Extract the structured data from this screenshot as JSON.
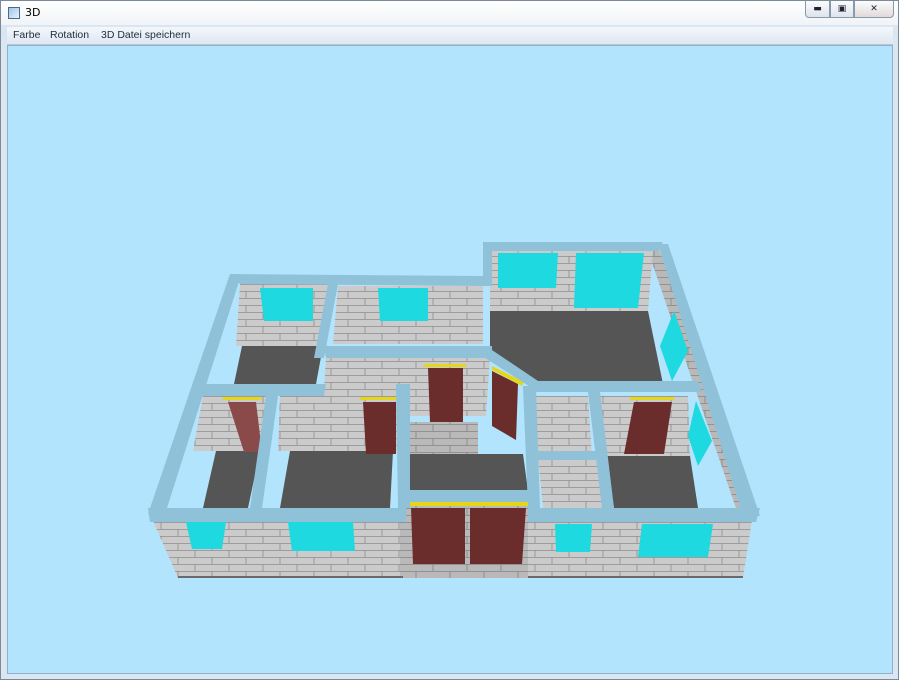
{
  "window": {
    "title": "3D",
    "app_icon": "window-icon",
    "controls": {
      "minimize": "minimize-icon",
      "maximize": "maximize-icon",
      "close": "close-icon"
    }
  },
  "menu": {
    "items": [
      {
        "label": "Farbe"
      },
      {
        "label": "Rotation"
      },
      {
        "label": "3D Datei speichern"
      }
    ]
  },
  "scene": {
    "background_color": "#b2e5fd",
    "wall_top_color": "#8fc1d9",
    "brick_color": "#c9c9c9",
    "floor_color": "#555555",
    "window_color": "#1ed9df",
    "door_color": "#6b2c2c",
    "lintel_color": "#e6d61a"
  }
}
